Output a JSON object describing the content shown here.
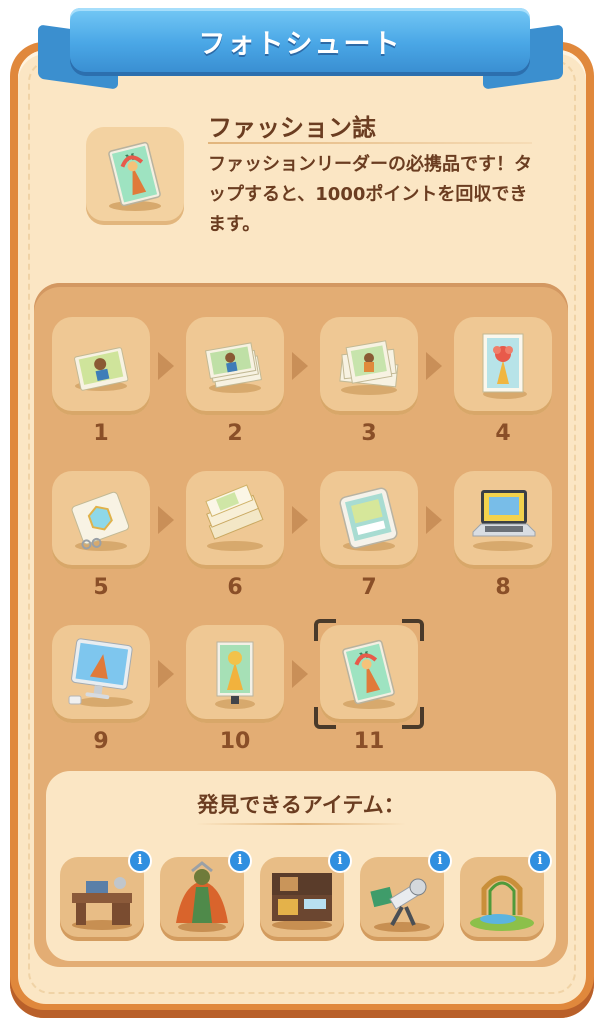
{
  "header": {
    "title": "フォトシュート",
    "ribbon_color": "#4aa7e6"
  },
  "featured": {
    "icon": "fashion-magazine-icon",
    "name": "ファッション誌",
    "description": "ファッションリーダーの必携品です！タップすると、1000ポイントを回収できます。"
  },
  "chain": {
    "items": [
      {
        "level": "1",
        "icon": "single-photo-icon"
      },
      {
        "level": "2",
        "icon": "photo-stack-icon"
      },
      {
        "level": "3",
        "icon": "photo-pile-icon"
      },
      {
        "level": "4",
        "icon": "framed-photo-icon"
      },
      {
        "level": "5",
        "icon": "photo-album-icon"
      },
      {
        "level": "6",
        "icon": "photo-books-icon"
      },
      {
        "level": "7",
        "icon": "tablet-icon"
      },
      {
        "level": "8",
        "icon": "laptop-icon"
      },
      {
        "level": "9",
        "icon": "desktop-monitor-icon"
      },
      {
        "level": "10",
        "icon": "magazine-stand-icon"
      },
      {
        "level": "11",
        "icon": "fashion-magazine-icon",
        "selected": true
      }
    ]
  },
  "discover": {
    "title": "発見できるアイテム：",
    "items": [
      {
        "icon": "photo-desk-icon"
      },
      {
        "icon": "costume-mannequin-icon"
      },
      {
        "icon": "treasure-case-icon"
      },
      {
        "icon": "camera-crane-icon"
      },
      {
        "icon": "garden-arch-icon"
      }
    ]
  }
}
